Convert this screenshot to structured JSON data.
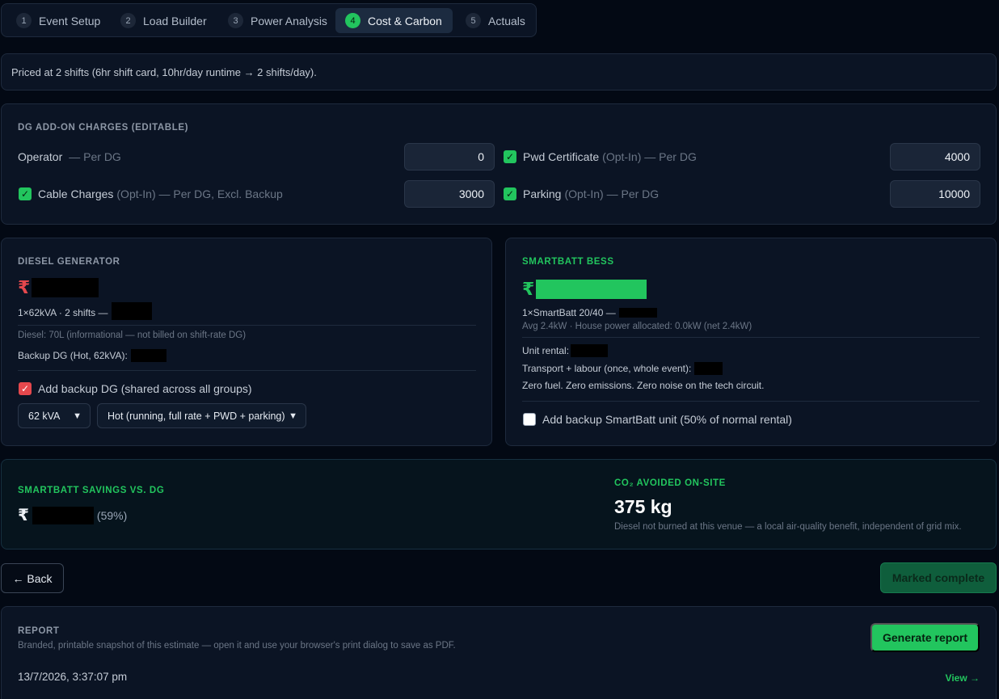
{
  "tabs": [
    {
      "num": "1",
      "label": "Event Setup"
    },
    {
      "num": "2",
      "label": "Load Builder"
    },
    {
      "num": "3",
      "label": "Power Analysis"
    },
    {
      "num": "4",
      "label": "Cost & Carbon"
    },
    {
      "num": "5",
      "label": "Actuals"
    }
  ],
  "active_tab": "Cost & Carbon",
  "notice": "Priced at 2 shifts (6hr shift card, 10hr/day runtime → 2 shifts/day).",
  "addons": {
    "title": "DG ADD-ON CHARGES (EDITABLE)",
    "operator": {
      "label": "Operator",
      "suffix": "— Per DG",
      "value": "0"
    },
    "pwd": {
      "label": "Pwd Certificate",
      "opt": "(Opt-In)",
      "suffix": "— Per DG",
      "value": "4000",
      "checked": true
    },
    "cable": {
      "label": "Cable Charges",
      "opt": "(Opt-In)",
      "suffix": "— Per DG, Excl. Backup",
      "value": "3000",
      "checked": true
    },
    "parking": {
      "label": "Parking",
      "opt": "(Opt-In)",
      "suffix": "— Per DG",
      "value": "10000",
      "checked": true
    }
  },
  "dg": {
    "title": "DIESEL GENERATOR",
    "currency": "₹",
    "config": "1×62kVA · 2 shifts —",
    "diesel_note": "Diesel: 70L (informational — not billed on shift-rate DG)",
    "backup_label": "Backup DG (Hot, 62kVA):",
    "add_backup_label": "Add backup DG (shared across all groups)",
    "add_backup_checked": true,
    "size_select": "62 kVA",
    "mode_select": "Hot (running, full rate + PWD + parking)"
  },
  "bess": {
    "title": "SMARTBATT BESS",
    "currency": "₹",
    "config": "1×SmartBatt 20/40 —",
    "avg": "Avg 2.4kW · House power allocated: 0.0kW (net 2.4kW)",
    "unit_rental": "Unit rental:",
    "transport": "Transport + labour (once, whole event):",
    "zero": "Zero fuel. Zero emissions. Zero noise on the tech circuit.",
    "add_backup_label": "Add backup SmartBatt unit (50% of normal rental)",
    "add_backup_checked": false
  },
  "savings": {
    "title": "SMARTBATT SAVINGS VS. DG",
    "currency": "₹",
    "percent": "(59%)",
    "co2_title": "CO₂ AVOIDED ON-SITE",
    "co2_value": "375 kg",
    "co2_note": "Diesel not burned at this venue — a local air-quality benefit, independent of grid mix."
  },
  "actions": {
    "back": "← Back",
    "marked": "Marked complete"
  },
  "report": {
    "title": "REPORT",
    "desc": "Branded, printable snapshot of this estimate — open it and use your browser's print dialog to save as PDF.",
    "generate": "Generate report",
    "timestamp": "13/7/2026, 3:37:07 pm",
    "view": "View →"
  },
  "colors": {
    "accent": "#22c55e",
    "danger": "#e5484d",
    "background": "#030914"
  }
}
